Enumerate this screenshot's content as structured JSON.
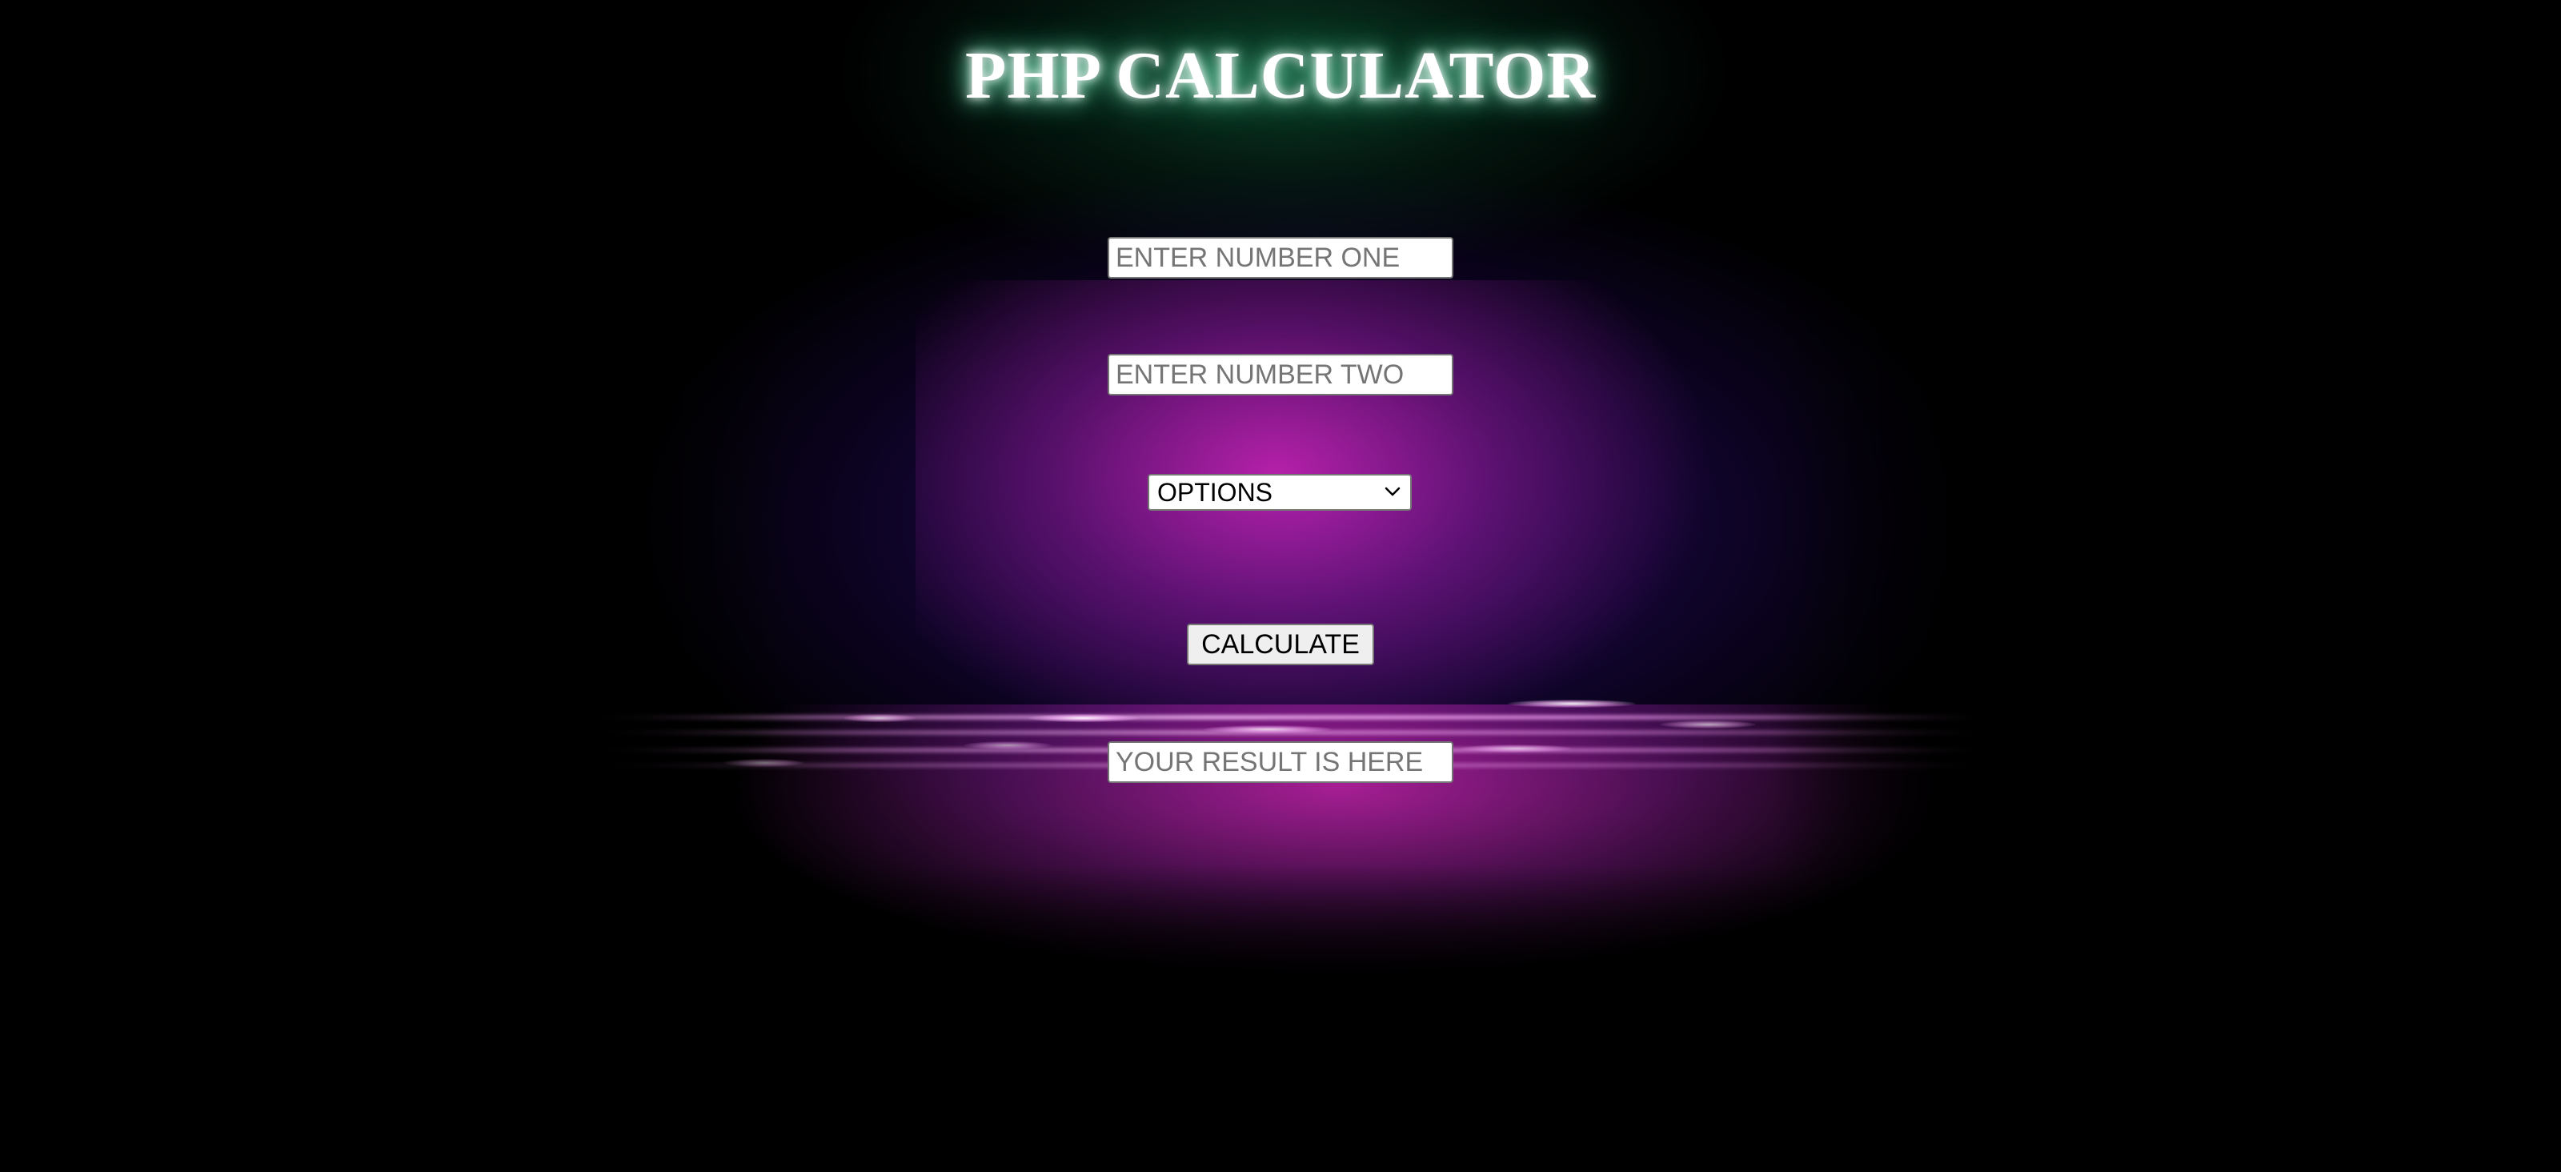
{
  "header": {
    "title": "PHP CALCULATOR"
  },
  "form": {
    "number_one": {
      "value": "",
      "placeholder": "ENTER NUMBER ONE"
    },
    "number_two": {
      "value": "",
      "placeholder": "ENTER NUMBER TWO"
    },
    "operation_select": {
      "selected": "OPTIONS",
      "icon": "chevron-down-icon"
    },
    "calculate_label": "CALCULATE",
    "result": {
      "value": "",
      "placeholder": "YOUR RESULT IS HERE"
    }
  },
  "theme": {
    "background": "#000000",
    "title_glow": "#3ccf95",
    "accent_magenta": "#e628c8",
    "accent_purple": "#46149f"
  }
}
